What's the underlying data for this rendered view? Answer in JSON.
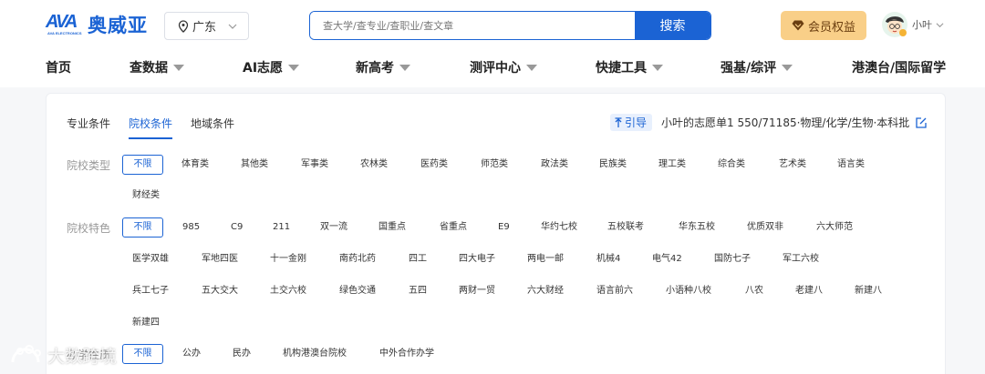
{
  "header": {
    "logo_mark": "AVA",
    "logo_sub": "AVA ELECTRONICS",
    "brand_name": "奥威亚",
    "region": "广东",
    "search_placeholder": "查大学/查专业/查职业/查文章",
    "search_button": "搜索",
    "vip_label": "会员权益",
    "username": "小叶"
  },
  "nav": {
    "items": [
      {
        "label": "首页",
        "dropdown": false
      },
      {
        "label": "查数据",
        "dropdown": true
      },
      {
        "label": "AI志愿",
        "dropdown": true
      },
      {
        "label": "新高考",
        "dropdown": true
      },
      {
        "label": "测评中心",
        "dropdown": true
      },
      {
        "label": "快捷工具",
        "dropdown": true
      },
      {
        "label": "强基/综评",
        "dropdown": true
      },
      {
        "label": "港澳台/国际留学",
        "dropdown": false
      }
    ]
  },
  "panel": {
    "tabs": [
      "专业条件",
      "院校条件",
      "地域条件"
    ],
    "active_tab": 1,
    "guide_tag": "引导",
    "guide_text": "小叶的志愿单1  550/71185·物理/化学/生物·本科批",
    "filters": [
      {
        "label": "院校类型",
        "options": [
          "不限",
          "体育类",
          "其他类",
          "军事类",
          "农林类",
          "医药类",
          "师范类",
          "政法类",
          "民族类",
          "理工类",
          "综合类",
          "艺术类",
          "语言类",
          "财经类"
        ]
      },
      {
        "label": "院校特色",
        "options": [
          "不限",
          "985",
          "C9",
          "211",
          "双一流",
          "国重点",
          "省重点",
          "E9",
          "华约七校",
          "五校联考",
          "华东五校",
          "优质双非",
          "六大师范",
          "医学双雄",
          "军地四医",
          "十一金刚",
          "南药北药",
          "四工",
          "四大电子",
          "两电一邮",
          "机械4",
          "电气42",
          "国防七子",
          "军工六校",
          "兵工七子",
          "五大交大",
          "土交六校",
          "绿色交通",
          "五四",
          "两财一贸",
          "六大财经",
          "语言前六",
          "小语种八校",
          "八农",
          "老建八",
          "新建八",
          "新建四"
        ]
      },
      {
        "label": "办学性质",
        "options": [
          "不限",
          "公办",
          "民办",
          "机构港澳台院校",
          "中外合作办学"
        ]
      }
    ]
  },
  "watermark": "大数跨境",
  "colors": {
    "accent": "#1b63d4",
    "vip": "#f9cf88"
  }
}
